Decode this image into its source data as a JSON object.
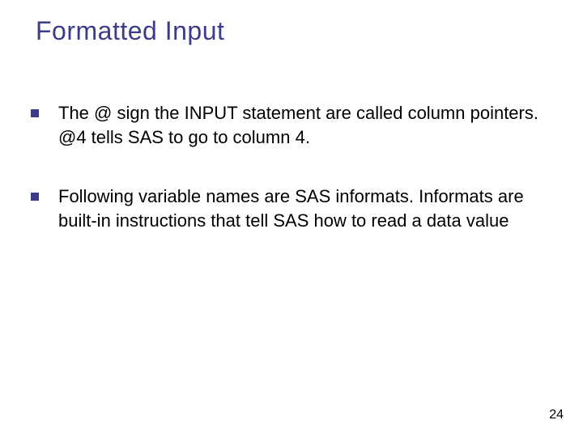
{
  "title": "Formatted Input",
  "bullets": [
    "The @ sign the INPUT statement are called column pointers. @4 tells SAS to go to column 4.",
    "Following variable names are SAS informats. Informats are built-in instructions that tell SAS how to read a data value"
  ],
  "page_number": "24"
}
